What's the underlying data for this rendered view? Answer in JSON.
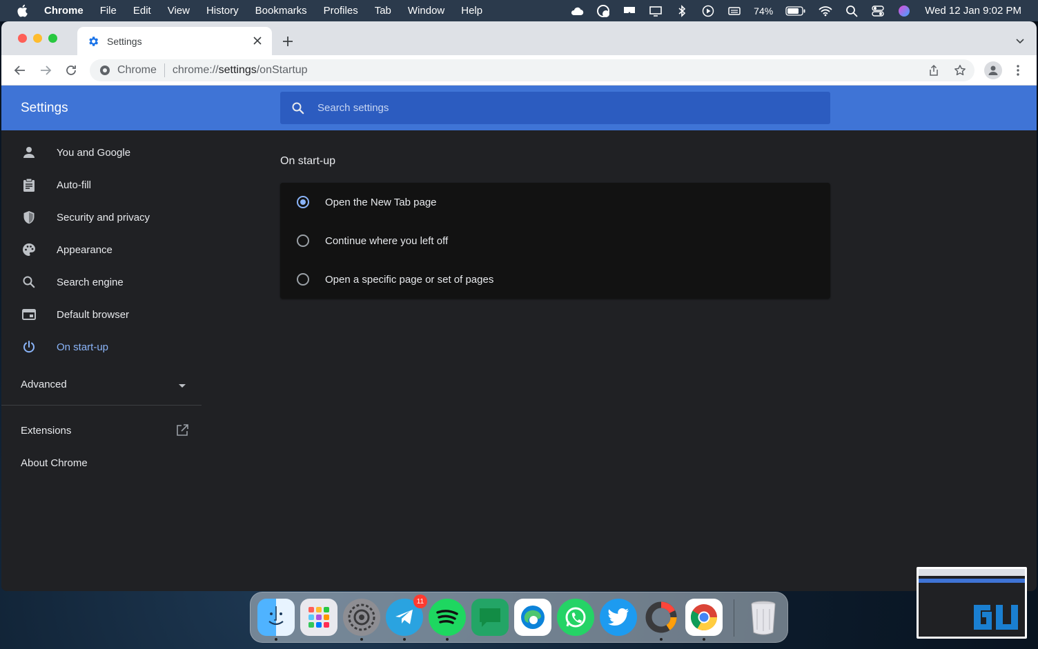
{
  "menubar": {
    "items": [
      "Chrome",
      "File",
      "Edit",
      "View",
      "History",
      "Bookmarks",
      "Profiles",
      "Tab",
      "Window",
      "Help"
    ],
    "battery": "74%",
    "clock": "Wed 12 Jan  9:02 PM"
  },
  "browser": {
    "tab_title": "Settings",
    "omnibox": {
      "site_name": "Chrome",
      "url_scheme": "chrome://",
      "url_host": "settings",
      "url_path": "/onStartup"
    }
  },
  "settings": {
    "header_title": "Settings",
    "search_placeholder": "Search settings",
    "nav": [
      {
        "label": "You and Google",
        "icon": "person-icon"
      },
      {
        "label": "Auto-fill",
        "icon": "clipboard-icon"
      },
      {
        "label": "Security and privacy",
        "icon": "shield-icon"
      },
      {
        "label": "Appearance",
        "icon": "palette-icon"
      },
      {
        "label": "Search engine",
        "icon": "search-icon"
      },
      {
        "label": "Default browser",
        "icon": "browser-window-icon"
      },
      {
        "label": "On start-up",
        "icon": "power-icon",
        "active": true
      }
    ],
    "advanced_label": "Advanced",
    "extensions_label": "Extensions",
    "about_label": "About Chrome",
    "section_title": "On start-up",
    "options": [
      {
        "label": "Open the New Tab page",
        "checked": true
      },
      {
        "label": "Continue where you left off",
        "checked": false
      },
      {
        "label": "Open a specific page or set of pages",
        "checked": false
      }
    ]
  },
  "dock": {
    "telegram_badge": "11",
    "apps": [
      "finder-icon",
      "launchpad-icon",
      "system-preferences-icon",
      "telegram-icon",
      "spotify-icon",
      "messages-icon",
      "edge-icon",
      "whatsapp-icon",
      "twitter-icon",
      "activity-icon",
      "chrome-icon",
      "trash-icon"
    ]
  },
  "colors": {
    "accent": "#3f74d6",
    "active_nav": "#8ab4f8",
    "background": "#202124"
  }
}
